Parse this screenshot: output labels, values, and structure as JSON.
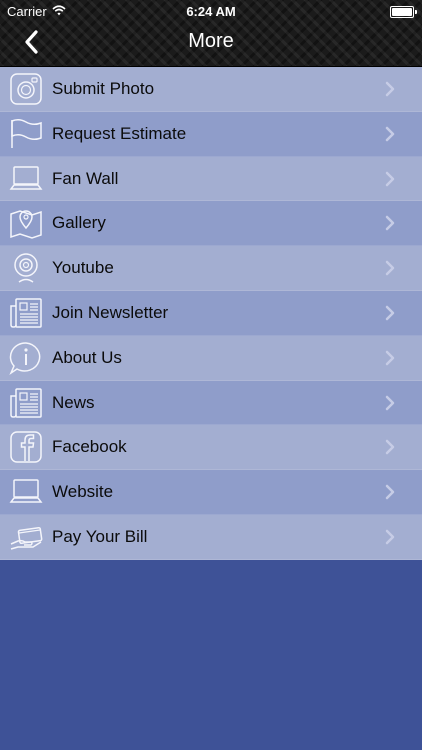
{
  "statusbar": {
    "carrier": "Carrier",
    "time": "6:24 AM"
  },
  "header": {
    "title": "More",
    "back_icon": "chevron-left-icon"
  },
  "menu": {
    "items": [
      {
        "label": "Submit Photo",
        "icon": "camera-icon"
      },
      {
        "label": "Request Estimate",
        "icon": "flag-icon"
      },
      {
        "label": "Fan Wall",
        "icon": "laptop-icon"
      },
      {
        "label": "Gallery",
        "icon": "map-pin-icon"
      },
      {
        "label": "Youtube",
        "icon": "webcam-icon"
      },
      {
        "label": "Join Newsletter",
        "icon": "newspaper-icon"
      },
      {
        "label": "About Us",
        "icon": "info-icon"
      },
      {
        "label": "News",
        "icon": "newspaper-icon"
      },
      {
        "label": "Facebook",
        "icon": "facebook-icon"
      },
      {
        "label": "Website",
        "icon": "laptop-icon"
      },
      {
        "label": "Pay Your Bill",
        "icon": "credit-card-hand-icon"
      }
    ]
  },
  "colors": {
    "row_light": "#a3aed1",
    "row_dark": "#8f9dca",
    "background": "#3e5297",
    "header": "#1b1b1b"
  }
}
